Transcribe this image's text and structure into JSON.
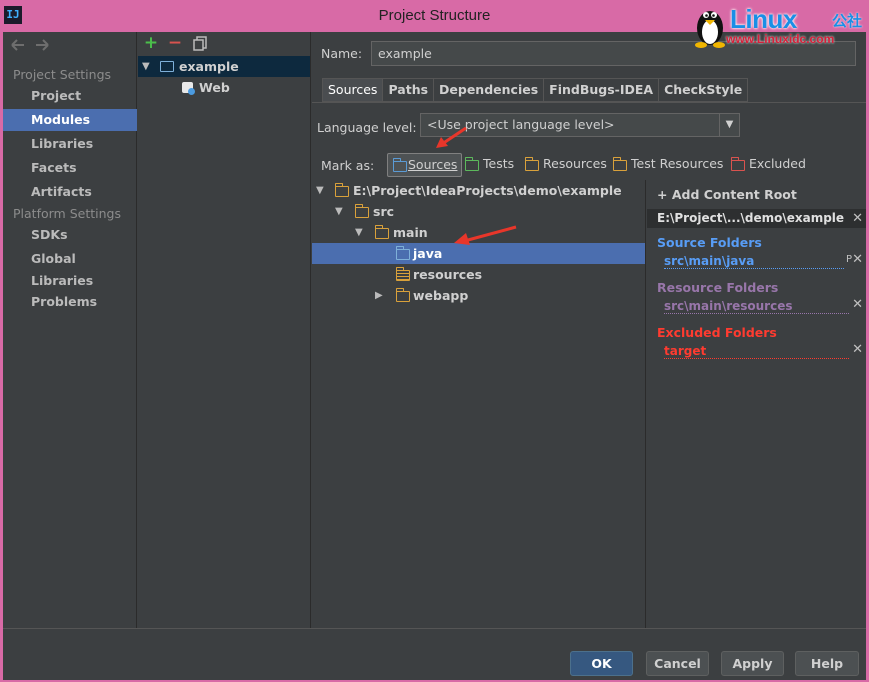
{
  "window": {
    "title": "Project Structure",
    "app_icon": "IJ"
  },
  "watermark": {
    "brand": "Linux",
    "cn": "公社",
    "url": "www.Linuxidc.com"
  },
  "nav": {
    "project_settings_header": "Project Settings",
    "project_items": [
      "Project",
      "Modules",
      "Libraries",
      "Facets",
      "Artifacts"
    ],
    "selected": "Modules",
    "platform_settings_header": "Platform Settings",
    "platform_items": [
      "SDKs",
      "Global Libraries"
    ],
    "problems": "Problems"
  },
  "modules": {
    "toolbar": {
      "add": "+",
      "remove": "−"
    },
    "tree": [
      {
        "label": "example",
        "level": 0,
        "expanded": true,
        "selected": true
      },
      {
        "label": "Web",
        "level": 1
      }
    ]
  },
  "main": {
    "name_label": "Name:",
    "name_value": "example",
    "tabs": [
      "Sources",
      "Paths",
      "Dependencies",
      "FindBugs-IDEA",
      "CheckStyle"
    ],
    "active_tab": "Sources",
    "language_level_label": "Language level:",
    "language_level_value": "<Use project language level>",
    "mark_as_label": "Mark as:",
    "mark_as": [
      {
        "label": "Sources",
        "color": "#5b9bd5",
        "active": true
      },
      {
        "label": "Tests",
        "color": "#5cb85c"
      },
      {
        "label": "Resources",
        "color": "#d9a13b"
      },
      {
        "label": "Test Resources",
        "color": "#d9a13b"
      },
      {
        "label": "Excluded",
        "color": "#d9534f"
      }
    ]
  },
  "content_tree": [
    {
      "label": "E:\\Project\\IdeaProjects\\demo\\example",
      "level": 0,
      "expanded": true
    },
    {
      "label": "src",
      "level": 1,
      "expanded": true
    },
    {
      "label": "main",
      "level": 2,
      "expanded": true
    },
    {
      "label": "java",
      "level": 3,
      "selected": true,
      "kind": "source"
    },
    {
      "label": "resources",
      "level": 3,
      "kind": "resource"
    },
    {
      "label": "webapp",
      "level": 3,
      "collapsed": true
    }
  ],
  "content_roots": {
    "add_label": "+ Add Content Root",
    "root_path": "E:\\Project\\...\\demo\\example",
    "sections": [
      {
        "title": "Source Folders",
        "color": "#589df6",
        "path": "src\\main\\java",
        "extra": "P"
      },
      {
        "title": "Resource Folders",
        "color": "#9876aa",
        "path": "src\\main\\resources"
      },
      {
        "title": "Excluded Folders",
        "color": "#ff3b30",
        "path": "target"
      }
    ]
  },
  "buttons": {
    "ok": "OK",
    "cancel": "Cancel",
    "apply": "Apply",
    "help": "Help"
  }
}
